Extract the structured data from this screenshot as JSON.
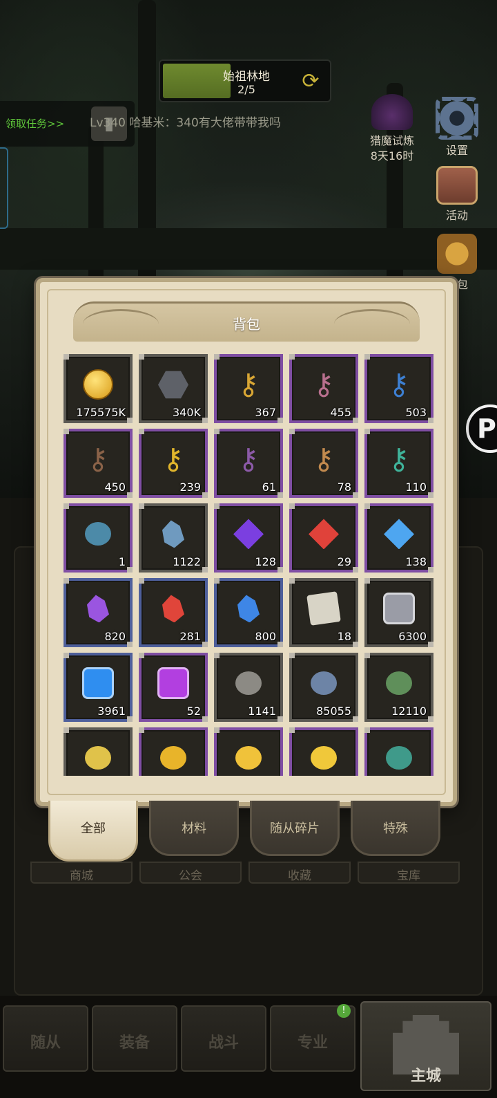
{
  "hud": {
    "location_name": "始祖林地",
    "location_progress": "2/5",
    "location_progress_value": 0.4,
    "quest_button": "领取任务>>",
    "chat_message": "Lv340 哈基米：340有大佬带带我吗",
    "hunt_event_label": "猎魔试炼",
    "hunt_event_timer": "8天16时",
    "settings_label": "设置",
    "activity_label": "活动",
    "gift_label": "礼包"
  },
  "inventory": {
    "title": "背包",
    "items": [
      {
        "icon": "gold-coin-icon",
        "qty": "175575K",
        "rarity": "gray",
        "color": "#e3b52a"
      },
      {
        "icon": "stone-icon",
        "qty": "340K",
        "rarity": "gray",
        "color": "#5e6168"
      },
      {
        "icon": "gold-key-icon",
        "qty": "367",
        "rarity": "purple",
        "color": "#d8a634"
      },
      {
        "icon": "pink-key-icon",
        "qty": "455",
        "rarity": "purple",
        "color": "#b8708e"
      },
      {
        "icon": "blue-key-icon",
        "qty": "503",
        "rarity": "purple",
        "color": "#3d7fd1"
      },
      {
        "icon": "bronze-key-icon",
        "qty": "450",
        "rarity": "purple",
        "color": "#8a6248"
      },
      {
        "icon": "golden-ornate-key-icon",
        "qty": "239",
        "rarity": "purple",
        "color": "#e0b52c"
      },
      {
        "icon": "violet-key-icon",
        "qty": "61",
        "rarity": "purple",
        "color": "#8c5aa8"
      },
      {
        "icon": "copper-key-icon",
        "qty": "78",
        "rarity": "purple",
        "color": "#c28a4e"
      },
      {
        "icon": "teal-key-icon",
        "qty": "110",
        "rarity": "purple",
        "color": "#3fb39a"
      },
      {
        "icon": "spell-book-icon",
        "qty": "1",
        "rarity": "purple",
        "color": "#4c8aa8"
      },
      {
        "icon": "crystal-shard-icon",
        "qty": "1122",
        "rarity": "gray",
        "color": "#6f9abf"
      },
      {
        "icon": "purple-gem-icon",
        "qty": "128",
        "rarity": "purple",
        "color": "#7b3fe0"
      },
      {
        "icon": "red-gem-icon",
        "qty": "29",
        "rarity": "purple",
        "color": "#e0423a"
      },
      {
        "icon": "blue-gem-icon",
        "qty": "138",
        "rarity": "purple",
        "color": "#4ea6f0"
      },
      {
        "icon": "purple-crystal-icon",
        "qty": "820",
        "rarity": "blue",
        "color": "#9a55e0"
      },
      {
        "icon": "red-crystal-icon",
        "qty": "281",
        "rarity": "blue",
        "color": "#e0453a"
      },
      {
        "icon": "blue-crystal-icon",
        "qty": "800",
        "rarity": "blue",
        "color": "#3e86e6"
      },
      {
        "icon": "scroll-icon",
        "qty": "18",
        "rarity": "gray",
        "color": "#d8d4c6"
      },
      {
        "icon": "silver-puzzle-icon",
        "qty": "6300",
        "rarity": "gray",
        "color": "#9a9ca6"
      },
      {
        "icon": "blue-puzzle-icon",
        "qty": "3961",
        "rarity": "blue",
        "color": "#2f8ef0"
      },
      {
        "icon": "purple-puzzle-icon",
        "qty": "52",
        "rarity": "purple",
        "color": "#b23fe0"
      },
      {
        "icon": "swirl-stone-icon",
        "qty": "1141",
        "rarity": "gray",
        "color": "#8c8a84"
      },
      {
        "icon": "ore-icon",
        "qty": "85055",
        "rarity": "gray",
        "color": "#6d84a6"
      },
      {
        "icon": "jade-coin-icon",
        "qty": "12110",
        "rarity": "gray",
        "color": "#5f8f5a"
      },
      {
        "icon": "gold-ring-icon",
        "qty": "",
        "rarity": "gray",
        "color": "#e0c24a"
      },
      {
        "icon": "gold-badge-icon",
        "qty": "",
        "rarity": "purple",
        "color": "#e8b42a"
      },
      {
        "icon": "gold-bar-icon",
        "qty": "",
        "rarity": "purple",
        "color": "#f0c23a"
      },
      {
        "icon": "gold-mushroom-icon",
        "qty": "",
        "rarity": "purple",
        "color": "#f0c83a"
      },
      {
        "icon": "jade-orb-icon",
        "qty": "",
        "rarity": "purple",
        "color": "#3f9a8a"
      }
    ]
  },
  "tabs": [
    {
      "label": "全部",
      "active": true
    },
    {
      "label": "材料",
      "active": false
    },
    {
      "label": "随从碎片",
      "active": false
    },
    {
      "label": "特殊",
      "active": false
    }
  ],
  "lower_tabs": [
    "商城",
    "公会",
    "收藏",
    "宝库"
  ],
  "bottom_nav": {
    "followers": "随从",
    "equipment": "装备",
    "battle": "战斗",
    "profession": "专业",
    "main_city": "主城",
    "badge": "!"
  }
}
